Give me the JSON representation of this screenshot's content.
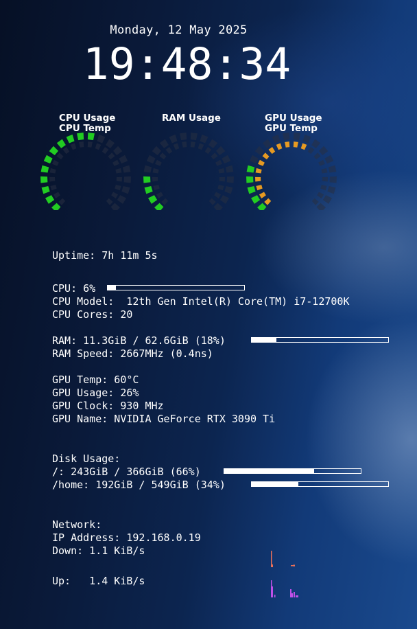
{
  "clock": {
    "date": "Monday, 12 May 2025",
    "time": "19:48:34"
  },
  "gauges": [
    {
      "name": "cpu",
      "title_lines": [
        "CPU Usage",
        "CPU Temp"
      ],
      "outer_color": "#22cc22",
      "outer_fraction": 0.55,
      "inner_color": null,
      "inner_fraction": 0
    },
    {
      "name": "ram",
      "title_lines": [
        "RAM Usage"
      ],
      "outer_color": "#22cc22",
      "outer_fraction": 0.18,
      "inner_color": null,
      "inner_fraction": 0
    },
    {
      "name": "gpu",
      "title_lines": [
        "GPU Usage",
        "GPU Temp"
      ],
      "outer_color": "#22cc22",
      "outer_fraction": 0.26,
      "inner_color": "#e69a22",
      "inner_fraction": 0.6
    }
  ],
  "uptime": "Uptime: 7h 11m 5s",
  "cpu": {
    "usage": "CPU: 6%",
    "usage_fraction": 0.06,
    "model": "CPU Model:  12th Gen Intel(R) Core(TM) i7-12700K",
    "cores": "CPU Cores: 20"
  },
  "ram": {
    "usage": "RAM: 11.3GiB / 62.6GiB (18%)",
    "usage_fraction": 0.18,
    "speed": "RAM Speed: 2667MHz (0.4ns)"
  },
  "gpu": {
    "temp": "GPU Temp: 60°C",
    "usage": "GPU Usage: 26%",
    "clock": "GPU Clock: 930 MHz",
    "name": "GPU Name: NVIDIA GeForce RTX 3090 Ti"
  },
  "disk": {
    "heading": "Disk Usage:",
    "root": "/: 243GiB / 366GiB (66%)",
    "root_fraction": 0.66,
    "home": "/home: 192GiB / 549GiB (34%)",
    "home_fraction": 0.34
  },
  "network": {
    "heading": "Network:",
    "ip": "IP Address: 192.168.0.19",
    "down": "Down: 1.1 KiB/s",
    "up": "Up:   1.4 KiB/s",
    "down_color": "#e8705a",
    "up_color": "#c050e8"
  }
}
